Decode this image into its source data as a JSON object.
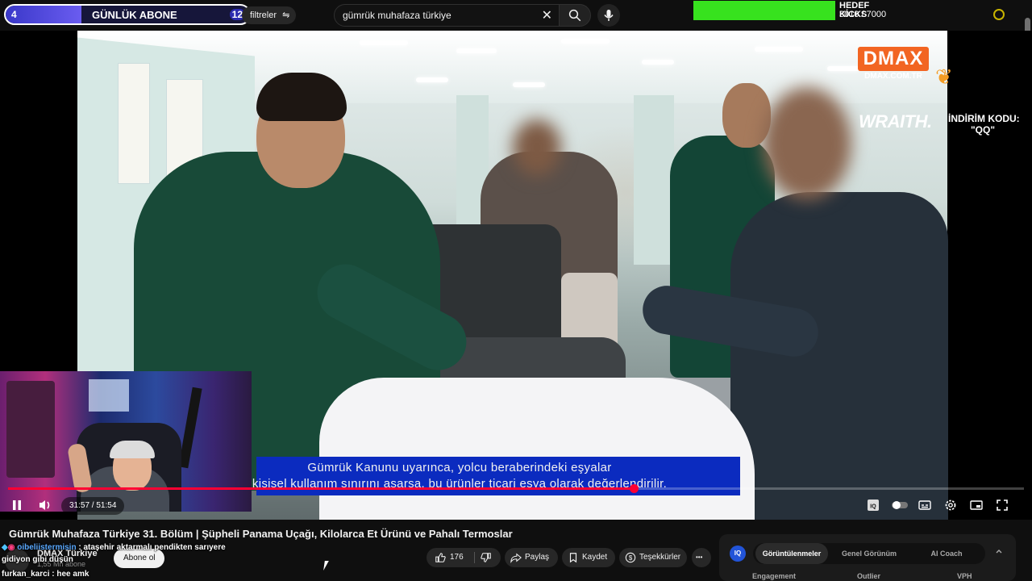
{
  "overlay": {
    "sub_goal": {
      "left_number": "4",
      "label": "GÜNLÜK ABONE",
      "right_number": "12",
      "progress": 0.31
    },
    "kick_goal": {
      "title": "HEDEF KİCKS",
      "value": "3010 / 7000",
      "progress": 0.43
    }
  },
  "header": {
    "filters_label": "filtreler",
    "search_query": "gümrük muhafaza türkiye"
  },
  "video": {
    "watermark_brand": "DMAX",
    "watermark_url": "DMAX.COM.TR",
    "sponsor": "WRAITH.",
    "sponsor_code_label": "İNDİRİM KODU:",
    "sponsor_code": "\"QQ\"",
    "subtitle_line1": "Gümrük Kanunu uyarınca, yolcu beraberindeki eşyalar",
    "subtitle_line2": "kişisel kullanım sınırını aşarsa, bu ürünler ticari eşya olarak değerlendirilir.",
    "time_current": "31:57",
    "time_total": "51:54",
    "time_display": "31:57 / 51:54",
    "played_fraction": 0.6157
  },
  "controls": {
    "play_state_icon": "pause-icon",
    "volume_icon": "volume-icon",
    "right_icons": [
      "iq-icon",
      "autoplay-toggle-icon",
      "captions-icon",
      "settings-icon",
      "miniplayer-icon",
      "fullscreen-icon"
    ]
  },
  "meta": {
    "title": "Gümrük Muhafaza Türkiye 31. Bölüm | Şüpheli Panama Uçağı, Kilolarca Et Ürünü ve Pahalı Termoslar",
    "channel_name": "DMAX Türkiye",
    "channel_subs": "1,55 Mn abone",
    "subscribe_label": "Abone ol",
    "like_count": "176",
    "share_label": "Paylaş",
    "save_label": "Kaydet",
    "thanks_label": "Teşekkürler",
    "more_label": "•••"
  },
  "chat": [
    {
      "user": "oibeliistermisin",
      "message": ": ataşehir aktarmalı pendikten sarıyere"
    },
    {
      "user": "gidiyon gibi düşün",
      "message": ""
    },
    {
      "user": "furkan_karci",
      "message": ": hee amk"
    }
  ],
  "iq_panel": {
    "badge": "IQ",
    "tabs": [
      "Görüntülenmeler",
      "Genel Görünüm",
      "AI Coach"
    ],
    "active_tab": 0,
    "columns": [
      "Engagement",
      "Outlier",
      "VPH"
    ],
    "collapse_icon": "chevron-up-icon"
  }
}
